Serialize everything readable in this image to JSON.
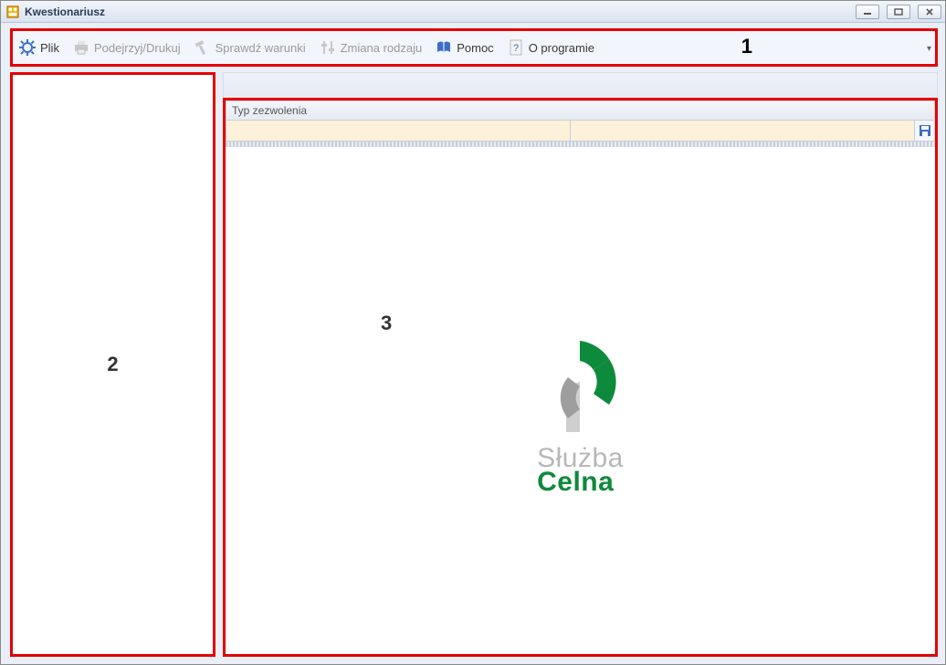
{
  "window": {
    "title": "Kwestionariusz"
  },
  "toolbar": {
    "file": "Plik",
    "print": "Podejrzyj/Drukuj",
    "check": "Sprawdź warunki",
    "change": "Zmiana rodzaju",
    "help": "Pomoc",
    "about": "O programie"
  },
  "annotations": {
    "toolbar": "1",
    "side": "2",
    "main": "3"
  },
  "section": {
    "typ_header": "Typ zezwolenia"
  },
  "logo": {
    "line1": "Służba",
    "line2": "Celna"
  }
}
